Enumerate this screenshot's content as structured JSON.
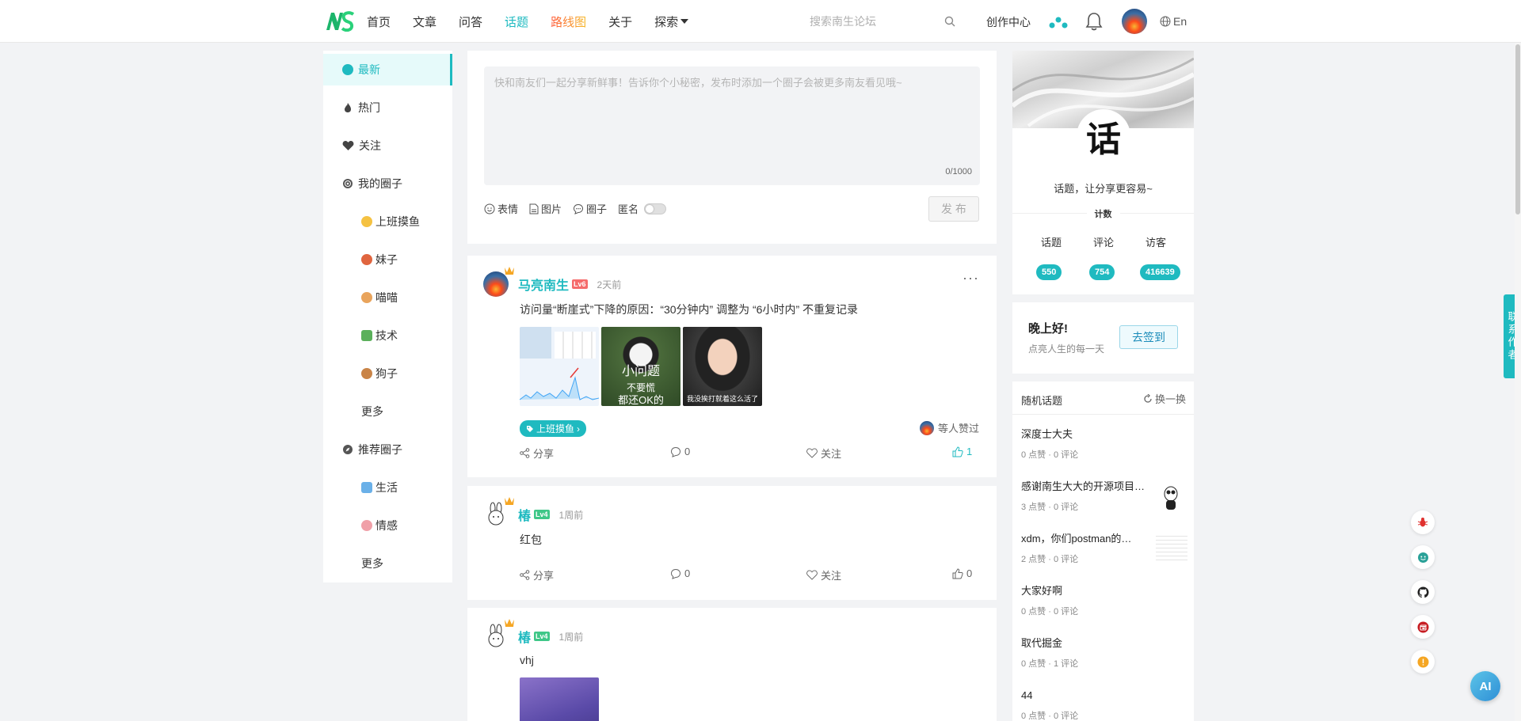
{
  "header": {
    "nav": [
      {
        "label": "首页",
        "active": false
      },
      {
        "label": "文章",
        "active": false
      },
      {
        "label": "问答",
        "active": false
      },
      {
        "label": "话题",
        "active": true
      },
      {
        "label": "路线图",
        "active": false
      },
      {
        "label": "关于",
        "active": false
      }
    ],
    "explore_label": "探索",
    "search_placeholder": "搜索南生论坛",
    "create_label": "创作中心",
    "lang_label": "En",
    "accent": "#1fbac0"
  },
  "leftnav": {
    "latest": "最新",
    "hot": "热门",
    "follow": "关注",
    "my_circles": "我的圈子",
    "my_circle_items": [
      "上班摸鱼",
      "妹子",
      "喵喵",
      "技术",
      "狗子"
    ],
    "more1": "更多",
    "recommended": "推荐圈子",
    "recommended_items": [
      "生活",
      "情感"
    ],
    "more2": "更多"
  },
  "composer": {
    "placeholder": "快和南友们一起分享新鲜事！告诉你个小秘密，发布时添加一个圈子会被更多南友看见哦~",
    "counter": "0/1000",
    "emoji": "表情",
    "image": "图片",
    "circle": "圈子",
    "anonymous": "匿名",
    "publish": "发 布"
  },
  "posts": [
    {
      "author": "马亮南生",
      "level": "Lv6",
      "time": "2天前",
      "text": "访问量“断崖式”下降的原因：“30分钟内” 调整为 “6小时内” 不重复记录",
      "images": [
        {
          "caption": ""
        },
        {
          "caption_line1": "小问题",
          "caption_line2": "不要慌",
          "caption_line3": "都还OK的"
        },
        {
          "caption": "我没挨打就着这么活了"
        }
      ],
      "tag": "上班摸鱼",
      "liked_by": "等人赞过",
      "share": "分享",
      "comments": "0",
      "follow": "关注",
      "likes": "1"
    },
    {
      "author": "椿",
      "level": "Lv4",
      "time": "1周前",
      "text": "红包",
      "share": "分享",
      "comments": "0",
      "follow": "关注",
      "likes": "0"
    },
    {
      "author": "椿",
      "level": "Lv4",
      "time": "1周前",
      "text": "vhj"
    }
  ],
  "profile": {
    "badge_char": "话",
    "slogan": "话题，让分享更容易~",
    "count_title": "计数",
    "stats": [
      {
        "label": "话题",
        "value": "550"
      },
      {
        "label": "评论",
        "value": "754"
      },
      {
        "label": "访客",
        "value": "416639"
      }
    ]
  },
  "greeting": {
    "title": "晚上好!",
    "subtitle": "点亮人生的每一天",
    "button": "去签到"
  },
  "random_topics": {
    "title": "随机话题",
    "change": "换一换",
    "items": [
      {
        "title": "深度士大夫",
        "meta": "0 点赞 · 0 评论"
      },
      {
        "title": "感谢南生大大的开源项目…",
        "meta": "3 点赞 · 0 评论"
      },
      {
        "title": "xdm，你们postman的…",
        "meta": "2 点赞 · 0 评论"
      },
      {
        "title": "大家好啊",
        "meta": "0 点赞 · 0 评论"
      },
      {
        "title": "取代掘金",
        "meta": "0 点赞 · 1 评论"
      },
      {
        "title": "44",
        "meta": "0 点赞 · 0 评论"
      }
    ]
  },
  "contact_label": "联系作者",
  "ai_label": "AI"
}
